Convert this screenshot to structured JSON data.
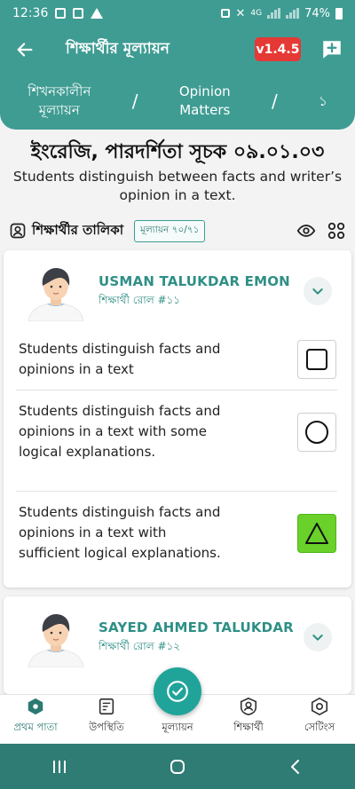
{
  "status_bar": {
    "time": "12:36",
    "battery": "74%",
    "network": "4G"
  },
  "app_bar": {
    "title": "শিক্ষার্থীর মূল্যায়ন",
    "version": "v1.4.5"
  },
  "breadcrumb": {
    "items": [
      {
        "line1": "শিখনকালীন",
        "line2": "মূল্যায়ন"
      },
      {
        "line1": "Opinion",
        "line2": "Matters"
      },
      {
        "line1": "১",
        "line2": ""
      }
    ],
    "separator": "/"
  },
  "subject": {
    "title": "ইংরেজি, পারদর্শিতা সূচক ০৯.০১.০৩",
    "description": "Students distinguish  between facts and writer’s opinion in a text."
  },
  "student_list": {
    "label": "শিক্ষার্থীর তালিকা",
    "count": "মূল্যায়ন ৭০/৭১"
  },
  "students": [
    {
      "name": "USMAN TALUKDAR EMON",
      "roll": "শিক্ষার্থী রোল #১১",
      "options": [
        {
          "text": "Students distinguish facts and opinions in a text",
          "shape": "square",
          "selected": false
        },
        {
          "text": "Students distinguish facts and opinions in a text with some logical explanations.",
          "shape": "circle",
          "selected": false
        },
        {
          "text": "Students distinguish facts and opinions in a text with sufficient logical explanations.",
          "shape": "triangle",
          "selected": true
        }
      ]
    },
    {
      "name": "SAYED AHMED TALUKDAR",
      "roll": "শিক্ষার্থী রোল #১২"
    }
  ],
  "bottom_nav": [
    {
      "label": "প্রথম পাতা",
      "icon": "home-icon",
      "active": true
    },
    {
      "label": "উপস্থিতি",
      "icon": "attendance-icon",
      "active": false
    },
    {
      "label": "মূল্যায়ন",
      "icon": "assessment-icon",
      "active": false
    },
    {
      "label": "শিক্ষার্থী",
      "icon": "student-icon",
      "active": false
    },
    {
      "label": "সেটিংস",
      "icon": "settings-icon",
      "active": false
    }
  ],
  "colors": {
    "primary": "#3f9c93",
    "badge": "#e53935",
    "selected": "#69d129",
    "fab": "#20a49a"
  }
}
